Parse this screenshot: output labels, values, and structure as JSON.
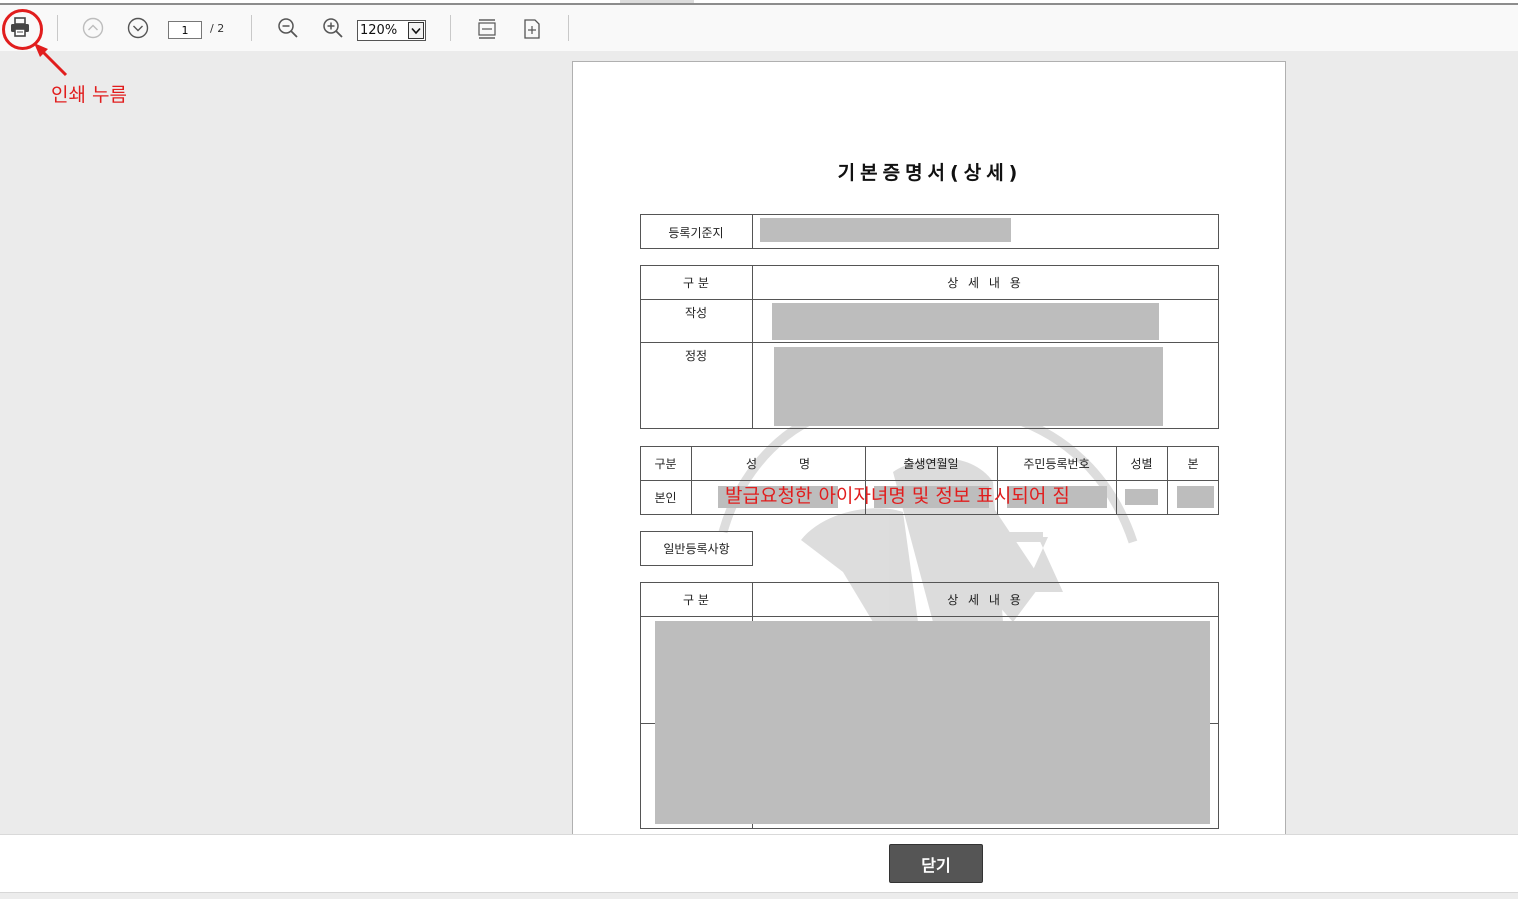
{
  "toolbar": {
    "page_current": "1",
    "page_total": "/ 2",
    "zoom_value": "120%",
    "zoom_options": [
      "120%"
    ],
    "icons": [
      "print-icon",
      "prev-page-icon",
      "next-page-icon",
      "zoom-out-icon",
      "zoom-in-icon",
      "fit-width-icon",
      "fit-page-icon"
    ]
  },
  "annotations": {
    "print_label": "인쇄 누름",
    "overlay_note": "발급요청한 아이자녀명 및 정보 표시되어 짐"
  },
  "document": {
    "title": "기본증명서(상세)",
    "reg_base_label": "등록기준지",
    "section1": {
      "header_left": "구 분",
      "header_right": "상 세 내 용",
      "row1": "작성",
      "row2": "정정"
    },
    "person_table": {
      "headers": [
        "구분",
        "성           명",
        "출생연월일",
        "주민등록번호",
        "성별",
        "본"
      ],
      "row_label": "본인"
    },
    "general_label": "일반등록사항",
    "section2": {
      "header_left": "구 분",
      "header_right": "상 세 내 용"
    }
  },
  "footer": {
    "close_label": "닫기"
  },
  "colors": {
    "annotation": "#e11d1d",
    "redaction": "#bdbdbd",
    "button": "#555555"
  }
}
